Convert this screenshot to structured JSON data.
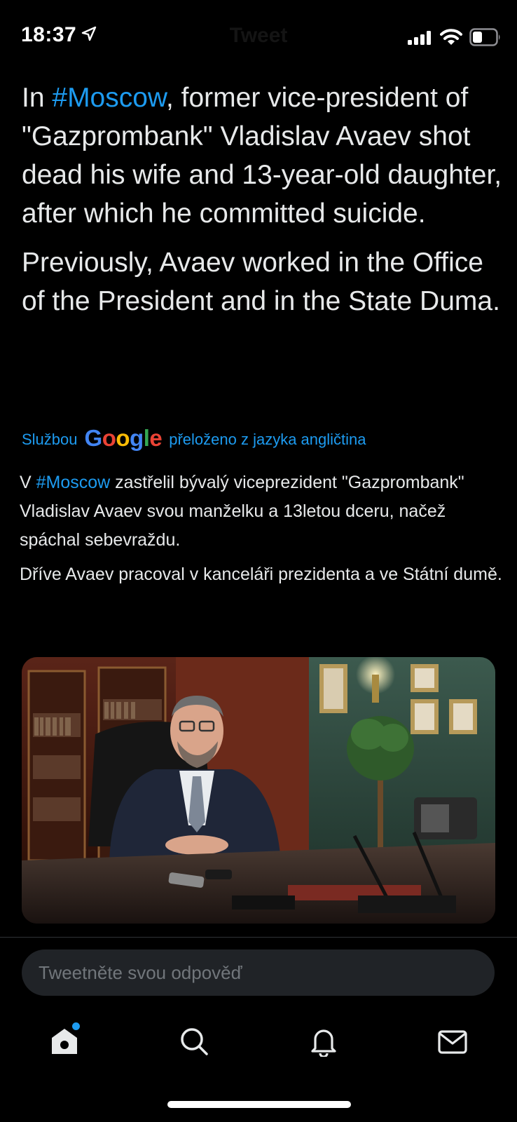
{
  "status_bar": {
    "time": "18:37",
    "screen_title": "Tweet"
  },
  "tweet": {
    "paragraph1": {
      "prefix": "In ",
      "hashtag": "#Moscow",
      "rest": ", former vice-president of \"Gazprombank\" Vladislav Avaev shot dead his wife and 13-year-old daughter, after which he committed suicide."
    },
    "paragraph2": "Previously, Avaev worked in the Office of the President and in the State Duma."
  },
  "translation": {
    "by_label": "Službou",
    "provider_logo_text": "Google",
    "from_label": "přeloženo z jazyka angličtina",
    "paragraph1": {
      "prefix": "V ",
      "hashtag": "#Moscow",
      "rest": " zastřelil bývalý viceprezident \"Gazprombank\" Vladislav Avaev svou manželku a 13letou dceru, načež spáchal sebevraždu."
    },
    "paragraph2": " Dříve Avaev pracoval v kanceláři prezidenta a ve Státní dumě."
  },
  "reply": {
    "placeholder": "Tweetněte svou odpověď"
  },
  "tab_bar": {
    "items": [
      "home-icon",
      "search-icon",
      "bell-icon",
      "mail-icon"
    ],
    "home_has_notification": true
  },
  "colors": {
    "background": "#000000",
    "text": "#e7e9ea",
    "accent": "#1d9bf0",
    "muted": "#71767b",
    "input_bg": "#202327"
  }
}
